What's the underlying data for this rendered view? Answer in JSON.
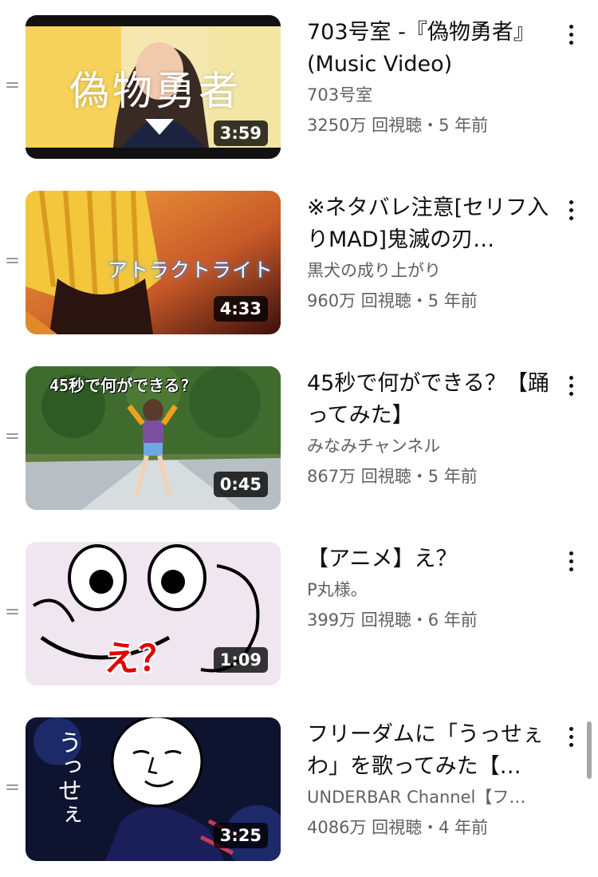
{
  "videos": [
    {
      "title": "703号室 -『偽物勇者』(Music Video)",
      "channel": "703号室",
      "meta": "3250万 回視聴・5 年前",
      "duration": "3:59",
      "thumb_text": "偽物勇者"
    },
    {
      "title": "※ネタバレ注意[セリフ入りMAD]鬼滅の刃…",
      "channel": "黒犬の成り上がり",
      "meta": "960万 回視聴・5 年前",
      "duration": "4:33",
      "thumb_text": "アトラクトライト"
    },
    {
      "title": "45秒で何ができる？【踊ってみた】",
      "channel": "みなみチャンネル",
      "meta": "867万 回視聴・5 年前",
      "duration": "0:45",
      "thumb_text": "45秒で何ができる?"
    },
    {
      "title": "【アニメ】え？",
      "channel": "P丸様。",
      "meta": "399万 回視聴・6 年前",
      "duration": "1:09",
      "thumb_text": "え？"
    },
    {
      "title": "フリーダムに「うっせぇわ」を歌ってみた【…",
      "channel": "UNDERBAR Channel【フ…",
      "meta": "4086万 回視聴・4 年前",
      "duration": "3:25",
      "thumb_text": "うっせぇ"
    }
  ],
  "icons": {
    "drag": "drag-handle-icon",
    "menu": "more-vert-icon"
  }
}
